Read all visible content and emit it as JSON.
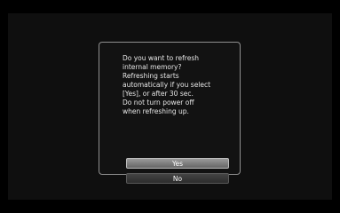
{
  "dialog": {
    "message": "Do you want to refresh\ninternal memory?\nRefreshing starts\nautomatically if you select\n[Yes], or after 30 sec.\nDo not turn power off\nwhen refreshing up.",
    "yes_label": "Yes",
    "no_label": "No"
  }
}
